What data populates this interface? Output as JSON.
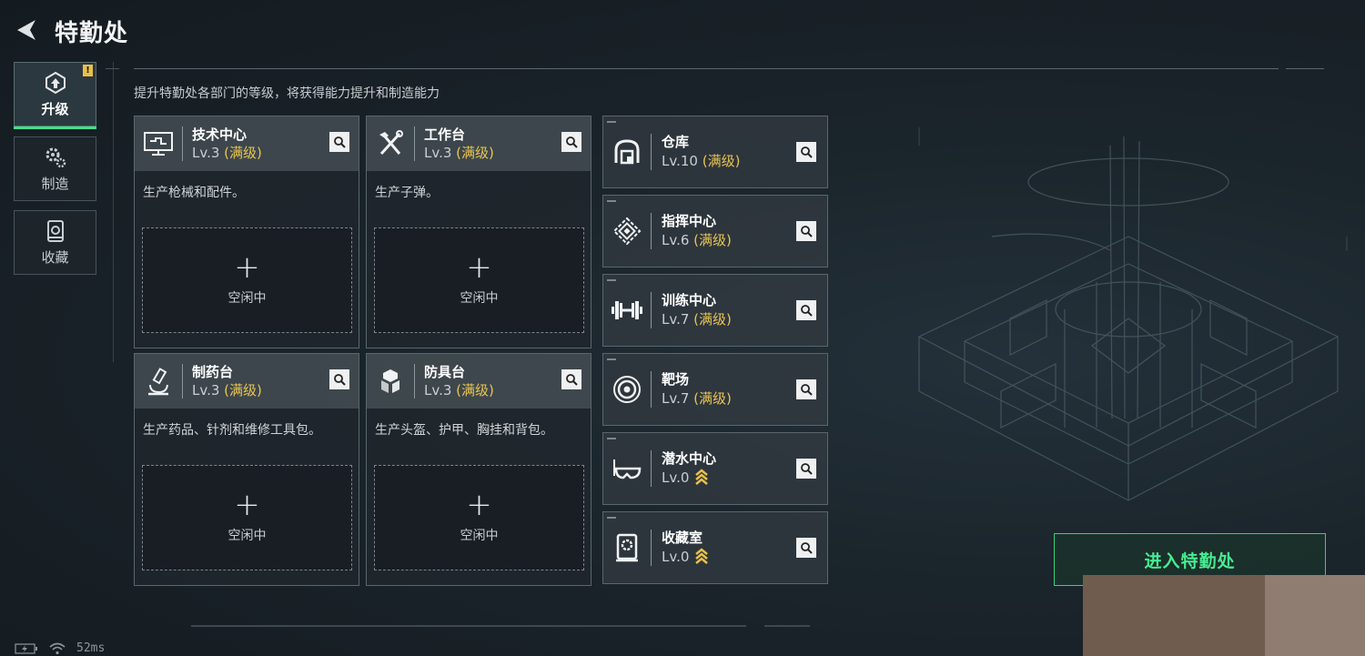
{
  "header": {
    "title": "特勤处"
  },
  "sidebar": {
    "tabs": [
      {
        "label": "升级",
        "icon": "upgrade-icon",
        "active": true,
        "badge": "!"
      },
      {
        "label": "制造",
        "icon": "gears-icon",
        "active": false
      },
      {
        "label": "收藏",
        "icon": "collection-icon",
        "active": false
      }
    ]
  },
  "subtitle": "提升特勤处各部门的等级，将获得能力提升和制造能力",
  "max_tag": "(满级)",
  "facilities": [
    {
      "name": "技术中心",
      "level": "Lv.3",
      "icon": "monitor-icon",
      "desc": "生产枪械和配件。",
      "slot_status": "空闲中"
    },
    {
      "name": "工作台",
      "level": "Lv.3",
      "icon": "tools-icon",
      "desc": "生产子弹。",
      "slot_status": "空闲中"
    },
    {
      "name": "制药台",
      "level": "Lv.3",
      "icon": "microscope-icon",
      "desc": "生产药品、针剂和维修工具包。",
      "slot_status": "空闲中"
    },
    {
      "name": "防具台",
      "level": "Lv.3",
      "icon": "armor-icon",
      "desc": "生产头盔、护甲、胸挂和背包。",
      "slot_status": "空闲中"
    }
  ],
  "departments": [
    {
      "name": "仓库",
      "level": "Lv.10",
      "maxed": true,
      "icon": "warehouse-icon"
    },
    {
      "name": "指挥中心",
      "level": "Lv.6",
      "maxed": true,
      "icon": "command-icon"
    },
    {
      "name": "训练中心",
      "level": "Lv.7",
      "maxed": true,
      "icon": "dumbbell-icon"
    },
    {
      "name": "靶场",
      "level": "Lv.7",
      "maxed": true,
      "icon": "target-icon"
    },
    {
      "name": "潜水中心",
      "level": "Lv.0",
      "maxed": false,
      "icon": "diving-mask-icon"
    },
    {
      "name": "收藏室",
      "level": "Lv.0",
      "maxed": false,
      "icon": "vault-icon"
    }
  ],
  "enter_button": "进入特勤处",
  "status": {
    "ping": "52ms"
  },
  "colors": {
    "accent_green": "#47ec92",
    "max_gold": "#e8c451",
    "upgrade_gold": "#e8c04a"
  }
}
